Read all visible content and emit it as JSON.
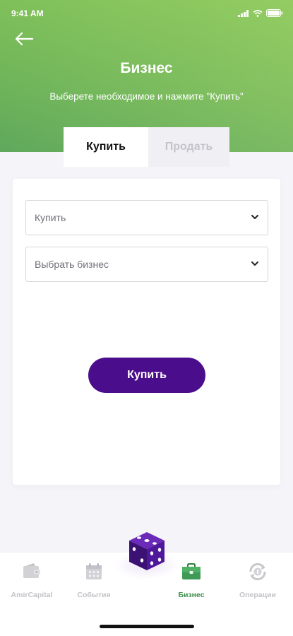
{
  "status": {
    "time": "9:41 AM"
  },
  "header": {
    "title": "Бизнес",
    "subtitle": "Выберете необходимое и нажмите \"Купить\""
  },
  "tabs": [
    {
      "label": "Купить",
      "active": true
    },
    {
      "label": "Продать",
      "active": false
    }
  ],
  "form": {
    "action_select": {
      "value": "Купить"
    },
    "business_select": {
      "value": "Выбрать бизнес"
    },
    "buy_label": "Купить"
  },
  "nav": [
    {
      "label": "AmirCapital",
      "icon": "wallet-icon",
      "active": false
    },
    {
      "label": "События",
      "icon": "calendar-icon",
      "active": false
    },
    {
      "label": "",
      "icon": "dice-icon",
      "active": false
    },
    {
      "label": "Бизнес",
      "icon": "briefcase-icon",
      "active": true
    },
    {
      "label": "Операции",
      "icon": "operations-icon",
      "active": false
    }
  ],
  "colors": {
    "header_green": "#6db35a",
    "accent_purple": "#4a0d8c",
    "active_nav": "#3e8f4a",
    "inactive_nav": "#c3c3c8"
  }
}
